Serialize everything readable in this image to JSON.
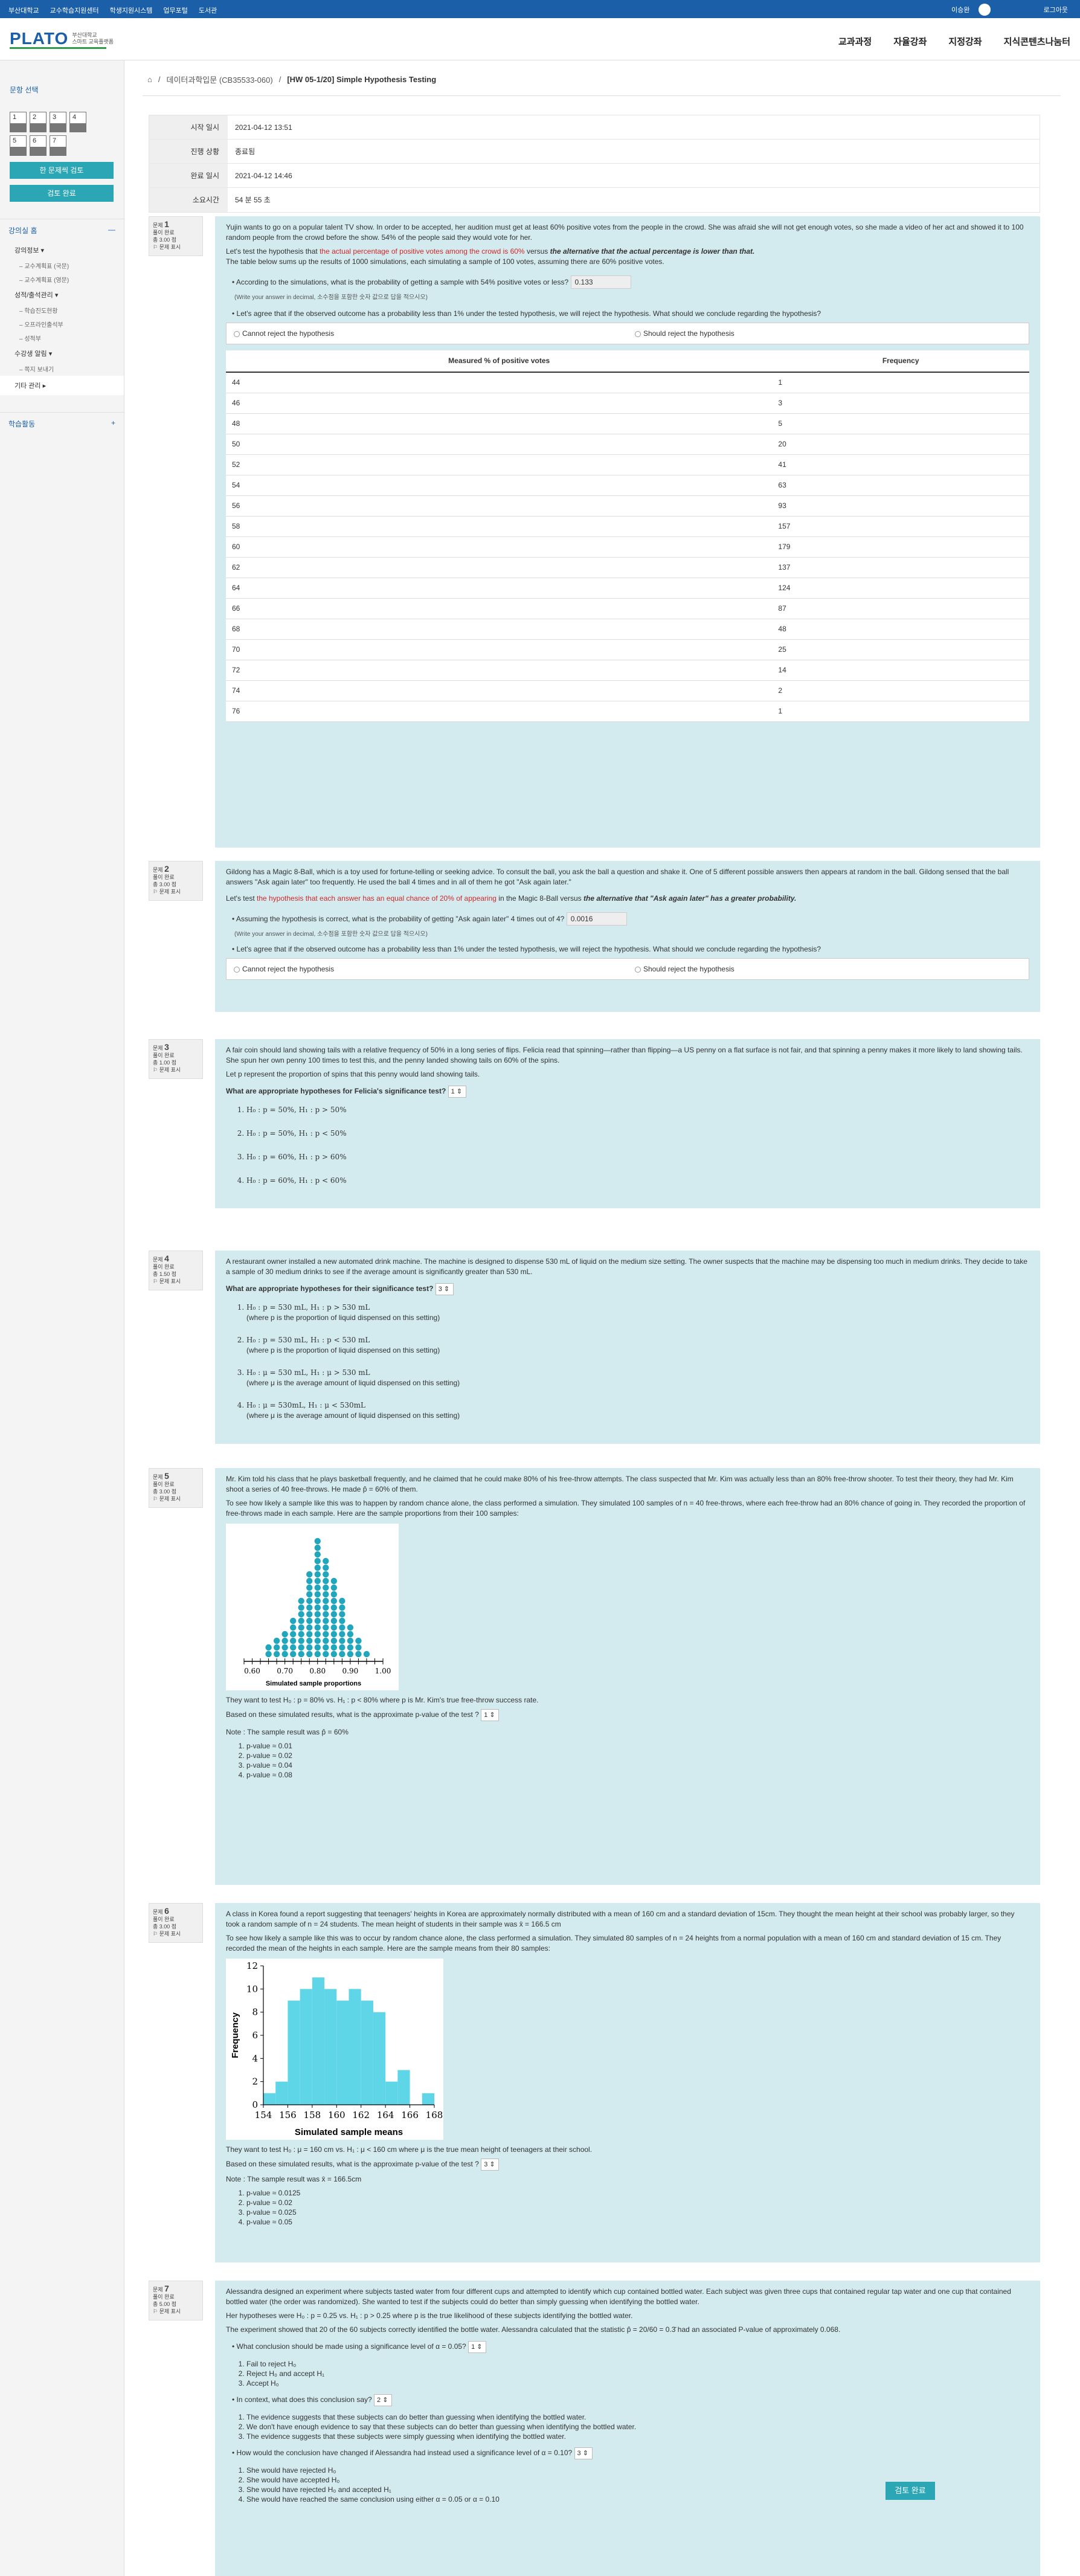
{
  "topbar": {
    "links": [
      "부산대학교",
      "교수학습지원센터",
      "학생지원시스템",
      "업무포털",
      "도서관"
    ],
    "user": "이승완",
    "logout": "로그아웃"
  },
  "logo": {
    "main": "PLATO",
    "sub1": "부산대학교",
    "sub2": "스마트 교육플랫폼"
  },
  "gnb": [
    "교과과정",
    "자율강좌",
    "지정강좌",
    "지식콘텐츠나눔터"
  ],
  "sidebar": {
    "title": "문항 선택",
    "qnums": [
      "1",
      "2",
      "3",
      "4",
      "5",
      "6",
      "7"
    ],
    "btn_all": "한 문제씩 검토",
    "btn_review": "검토 완료",
    "section1": "강의실 홈",
    "section1_icon": "—",
    "items": [
      {
        "label": "강의정보 ▾",
        "subs": [
          "교수계획표 (국문)",
          "교수계획표 (영문)"
        ]
      },
      {
        "label": "성적/출석관리 ▾",
        "subs": [
          "학습진도현황",
          "오프라인출석부",
          "성적부"
        ]
      },
      {
        "label": "수강생 알림 ▾",
        "subs": [
          "쪽지 보내기"
        ]
      }
    ],
    "active": "기타 관리 ▸",
    "section2": "학습활동",
    "section2_icon": "+"
  },
  "breadcrumb": {
    "course": "데이터과학입문 (CB35533-060)",
    "page": "[HW 05-1/20] Simple Hypothesis Testing"
  },
  "summary": [
    {
      "k": "시작 일시",
      "v": "2021-04-12 13:51"
    },
    {
      "k": "진행 상황",
      "v": "종료됨"
    },
    {
      "k": "완료 일시",
      "v": "2021-04-12 14:46"
    },
    {
      "k": "소요시간",
      "v": "54 분 55 초"
    }
  ],
  "qlabels": {
    "status": "풀이 완료",
    "flag": "문제 표시"
  },
  "q1": {
    "no": "1",
    "label": "문제",
    "score": "총 3.00 점",
    "text1": "Yujin wants to go on a popular talent TV show. In order to be accepted, her audition must get at least 60% positive votes from the people in the crowd. She was afraid she will not get enough votes, so she made a video of her act and showed it to 100 random people from the crowd before the show. 54% of the people said they would vote for her.",
    "h_pre": "Let's test the hypothesis that ",
    "h_null": "the actual percentage of positive votes among the crowd is 60%",
    "h_mid": " versus ",
    "h_alt": "the alternative that the actual percentage is lower than that.",
    "text2": "The table below sums up the results of 1000 simulations, each simulating a sample of 100 votes, assuming there are 60% positive votes.",
    "sub1": "According to the simulations, what is the probability of getting a sample with 54% positive votes or less?",
    "ans1": "0.133",
    "note": "(Write your answer in decimal, 소수점을 포함한 숫자 값으로 답을 적으시오)",
    "sub2": "Let's agree that if the observed outcome has a probability less than 1% under the tested hypothesis, we will reject the hypothesis. What should we conclude regarding the hypothesis?",
    "opt1": "Cannot reject the hypothesis",
    "opt2": "Should reject the hypothesis",
    "th1": "Measured % of positive votes",
    "th2": "Frequency",
    "rows": [
      [
        "44",
        "1"
      ],
      [
        "46",
        "3"
      ],
      [
        "48",
        "5"
      ],
      [
        "50",
        "20"
      ],
      [
        "52",
        "41"
      ],
      [
        "54",
        "63"
      ],
      [
        "56",
        "93"
      ],
      [
        "58",
        "157"
      ],
      [
        "60",
        "179"
      ],
      [
        "62",
        "137"
      ],
      [
        "64",
        "124"
      ],
      [
        "66",
        "87"
      ],
      [
        "68",
        "48"
      ],
      [
        "70",
        "25"
      ],
      [
        "72",
        "14"
      ],
      [
        "74",
        "2"
      ],
      [
        "76",
        "1"
      ]
    ]
  },
  "q2": {
    "no": "2",
    "label": "문제",
    "score": "총 3.00 점",
    "text1": "Gildong has a Magic 8-Ball, which is a toy used for fortune-telling or seeking advice. To consult the ball, you ask the ball a question and shake it. One of 5 different possible answers then appears at random in the ball. Gildong sensed that the ball answers \"Ask again later\" too frequently. He used the ball 4 times and in all of them he got \"Ask again later.\"",
    "h_pre": "Let's test ",
    "h_null": "the hypothesis that each answer has an equal chance of 20% of appearing",
    "h_mid": " in the Magic 8-Ball versus ",
    "h_alt": "the alternative that \"Ask again later\" has a greater probability.",
    "sub1": "Assuming the hypothesis is correct, what is the probability of getting \"Ask again later\" 4 times out of 4?",
    "ans1": "0.0016",
    "note": "(Write your answer in decimal, 소수점을 포함한 숫자 값으로 답을 적으시오)",
    "sub2": "Let's agree that if the observed outcome has a probability less than 1% under the tested hypothesis, we will reject the hypothesis. What should we conclude regarding the hypothesis?",
    "opt1": "Cannot reject the hypothesis",
    "opt2": "Should reject the hypothesis"
  },
  "q3": {
    "no": "3",
    "label": "문제",
    "score": "총 1.00 점",
    "text1": "A fair coin should land showing tails with a relative frequency of 50% in a long series of flips. Felicia read that spinning—rather than flipping—a US penny on a flat surface is not fair, and that spinning a penny makes it more likely to land showing tails. She spun her own penny 100 times to test this, and the penny landed showing tails on 60% of the spins.",
    "text2": "Let p represent the proportion of spins that this penny would land showing tails.",
    "question": "What are appropriate hypotheses for Felicia's significance test?",
    "sel": "1 ⇕",
    "opts": [
      "H₀ : p = 50%, H₁ : p > 50%",
      "H₀ : p = 50%, H₁ : p < 50%",
      "H₀ : p = 60%, H₁ : p > 60%",
      "H₀ : p = 60%, H₁ : p < 60%"
    ]
  },
  "q4": {
    "no": "4",
    "label": "문제",
    "score": "총 1.50 점",
    "text1": "A restaurant owner installed a new automated drink machine. The machine is designed to dispense 530 mL of liquid on the medium size setting. The owner suspects that the machine may be dispensing too much in medium drinks. They decide to take a sample of 30 medium drinks to see if the average amount is significantly greater than 530 mL.",
    "question": "What are appropriate hypotheses for their significance test?",
    "sel": "3 ⇕",
    "opts": [
      {
        "h": "H₀ : p = 530 mL, H₁ : p > 530 mL",
        "n": "(where p is the proportion of liquid dispensed on this setting)"
      },
      {
        "h": "H₀ : p = 530 mL, H₁ : p < 530 mL",
        "n": "(where p is the proportion of liquid dispensed on this setting)"
      },
      {
        "h": "H₀ : μ = 530 mL, H₁ : μ > 530 mL",
        "n": "(where μ is the average amount of liquid dispensed on this setting)"
      },
      {
        "h": "H₀ : μ = 530mL, H₁ : μ < 530mL",
        "n": "(where μ is the average amount of liquid dispensed on this setting)"
      }
    ]
  },
  "q5": {
    "no": "5",
    "label": "문제",
    "score": "총 3.00 점",
    "text1": "Mr. Kim told his class that he plays basketball frequently, and he claimed that he could make 80% of his free-throw attempts. The class suspected that Mr. Kim was actually less than an 80% free-throw shooter. To test their theory, they had Mr. Kim shoot a series of 40 free-throws. He made p̂ = 60% of them.",
    "text2": "To see how likely a sample like this was to happen by random chance alone, the class performed a simulation. They simulated 100 samples of n = 40 free-throws, where each free-throw had an 80% chance of going in. They recorded the proportion of free-throws made in each sample. Here are the sample proportions from their 100 samples:",
    "text3": "They want to test H₀ : p = 80%  vs.  H₁ : p < 80% where p is Mr. Kim's true free-throw success rate.",
    "question": "Based on these simulated results, what is the approximate p-value of the test ?",
    "sel": "1 ⇕",
    "note": "Note : The sample result was p̂ = 60%",
    "opts": [
      "p-value ≈ 0.01",
      "p-value ≈ 0.02",
      "p-value ≈ 0.04",
      "p-value ≈ 0.08"
    ]
  },
  "q6": {
    "no": "6",
    "label": "문제",
    "score": "총 3.00 점",
    "text1": "A class in Korea found a report suggesting that teenagers' heights in Korea are approximately normally distributed with a mean of 160 cm and a standard deviation of 15cm. They thought the mean height at their school was probably larger, so they took a random sample of n = 24 students. The mean height of students in their sample was x̄ = 166.5 cm",
    "text2": "To see how likely a sample like this was to occur by random chance alone, the class performed a simulation. They simulated 80 samples of n = 24 heights from a normal population with a mean of 160 cm and standard deviation of 15 cm. They recorded the mean of the heights in each sample. Here are the sample means from their 80 samples:",
    "text3": "They want to test H₀ : μ = 160 cm  vs.  H₁ : μ < 160 cm where μ is the true mean height of teenagers at their school.",
    "question": "Based on these simulated results, what is the approximate p-value of the test ?",
    "sel": "3 ⇕",
    "note": "Note : The sample result was x̄ = 166.5cm",
    "opts": [
      "p-value ≈ 0.0125",
      "p-value ≈ 0.02",
      "p-value ≈ 0.025",
      "p-value ≈ 0.05"
    ]
  },
  "q7": {
    "no": "7",
    "label": "문제",
    "score": "총 5.00 점",
    "text1": "Alessandra designed an experiment where subjects tasted water from four different cups and attempted to identify which cup contained bottled water. Each subject was given three cups that contained regular tap water and one cup that contained bottled water (the order was randomized). She wanted to test if the subjects could do better than simply guessing when identifying the bottled water.",
    "text2": "Her hypotheses were H₀ : p = 0.25 vs. H₁ : p > 0.25  where p is the true likelihood of these subjects identifying the bottled water.",
    "text3": "The experiment showed that 20 of the 60 subjects correctly identified the bottle water. Alessandra calculated that the statistic p̂ = 20/60 = 0.3̄ had an associated P-value of approximately 0.068.",
    "sub1": "What conclusion should be made using a significance level of α = 0.05?",
    "sel1": "1 ⇕",
    "opts1": [
      "Fail to reject H₀",
      "Reject H₀ and accept H₁",
      "Accept H₀"
    ],
    "sub2": "In context, what does this conclusion say?",
    "sel2": "2 ⇕",
    "opts2": [
      "The evidence suggests that these subjects can do better than guessing when identifying the bottled water.",
      "We don't have enough evidence to say that these subjects can do better than guessing when identifying the bottled water.",
      "The evidence suggests that these subjects were simply guessing when identifying the bottled water."
    ],
    "sub3": "How would the conclusion have changed if Alessandra had instead used a significance level of α = 0.10?",
    "sel3": "3 ⇕",
    "opts3": [
      "She would have rejected H₀",
      "She would have accepted H₀",
      "She would have rejected H₀ and accepted H₁",
      "She would have reached the same conclusion using either α = 0.05 or α = 0.10"
    ]
  },
  "submit": "검토 완료",
  "chart_data": [
    {
      "type": "scatter",
      "xlabel": "Simulated sample proportions",
      "ylabel": "",
      "xlim": [
        0.575,
        1.0
      ],
      "xticks": [
        "0.60",
        "0.70",
        "0.80",
        "0.90",
        "1.00"
      ],
      "x": [
        0.65,
        0.675,
        0.7,
        0.725,
        0.75,
        0.775,
        0.8,
        0.825,
        0.85,
        0.875,
        0.9,
        0.925,
        0.95
      ],
      "counts": [
        2,
        3,
        4,
        6,
        9,
        13,
        18,
        15,
        12,
        9,
        5,
        3,
        1
      ]
    },
    {
      "type": "bar",
      "xlabel": "Simulated sample means",
      "ylabel": "Frequency",
      "ylim": [
        0,
        12
      ],
      "yticks": [
        "0",
        "2",
        "4",
        "6",
        "8",
        "10",
        "12"
      ],
      "xticks": [
        "154",
        "156",
        "158",
        "160",
        "162",
        "164",
        "166",
        "168"
      ],
      "bins": [
        154,
        155,
        156,
        157,
        158,
        159,
        160,
        161,
        162,
        163,
        164,
        165,
        166,
        167,
        168
      ],
      "values": [
        1,
        2,
        9,
        10,
        11,
        10,
        9,
        10,
        9,
        8,
        2,
        3,
        0,
        1
      ]
    }
  ]
}
